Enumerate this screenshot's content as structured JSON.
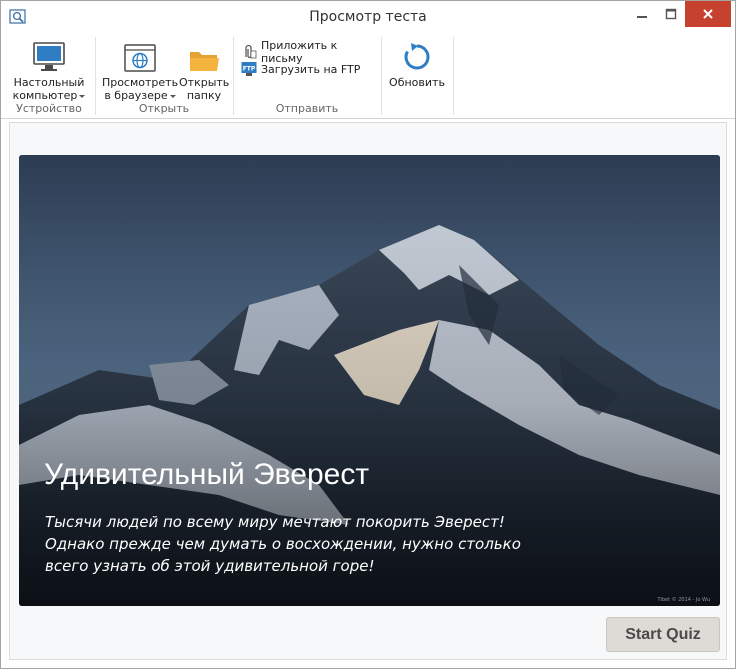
{
  "window": {
    "title": "Просмотр теста"
  },
  "ribbon": {
    "device_group": {
      "label": "Устройство",
      "desktop_button": {
        "line1": "Настольный",
        "line2": "компьютер"
      }
    },
    "open_group": {
      "label": "Открыть",
      "browser_button": {
        "line1": "Просмотреть",
        "line2": "в браузере"
      },
      "folder_button": {
        "line1": "Открыть",
        "line2": "папку"
      }
    },
    "send_group": {
      "label": "Отправить",
      "attach_label": "Приложить к письму",
      "ftp_label": "Загрузить на FTP"
    },
    "refresh_button": {
      "label": "Обновить"
    }
  },
  "slide": {
    "title": "Удивительный Эверест",
    "description": "Тысячи людей по всему миру мечтают покорить Эверест! Однако прежде чем думать о восхождении, нужно столько всего узнать об этой удивительной горе!",
    "photo_credit": "Tibet © 2014 - Jo Wu"
  },
  "quiz": {
    "start_label": "Start Quiz"
  },
  "colors": {
    "accent": "#1c6fb3",
    "close": "#c7412f",
    "folder": "#f3b33d"
  }
}
